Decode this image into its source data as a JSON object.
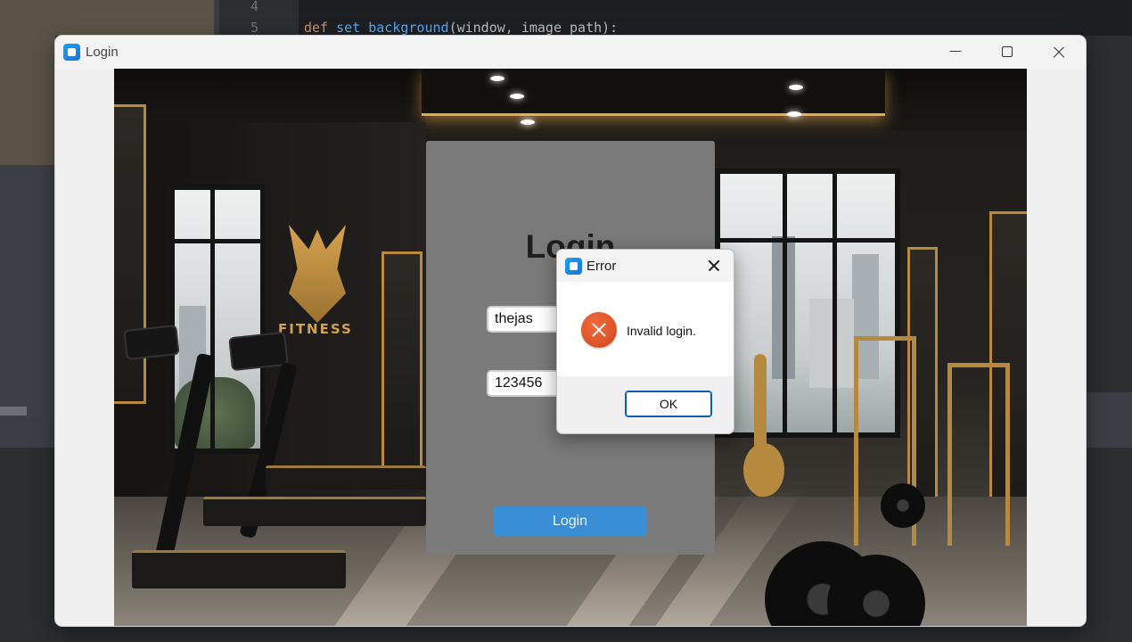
{
  "ide": {
    "line_numbers": [
      "4",
      "5"
    ],
    "code_line": {
      "keyword": "def",
      "function": "set_background",
      "rest": "(window, image_path):"
    }
  },
  "window": {
    "title": "Login",
    "controls": {
      "minimize": "minimize-icon",
      "maximize": "maximize-icon",
      "close": "close-icon"
    }
  },
  "background_image": {
    "logo_text": "FITNESS"
  },
  "login_form": {
    "heading": "Login",
    "username_value": "thejas",
    "password_value": "123456",
    "submit_label": "Login"
  },
  "error_dialog": {
    "title": "Error",
    "message": "Invalid login.",
    "ok_label": "OK",
    "icon": "error-icon"
  },
  "colors": {
    "accent_button": "#3a8ed5",
    "panel": "#7a7a7a",
    "error_icon": "#e0532a"
  }
}
